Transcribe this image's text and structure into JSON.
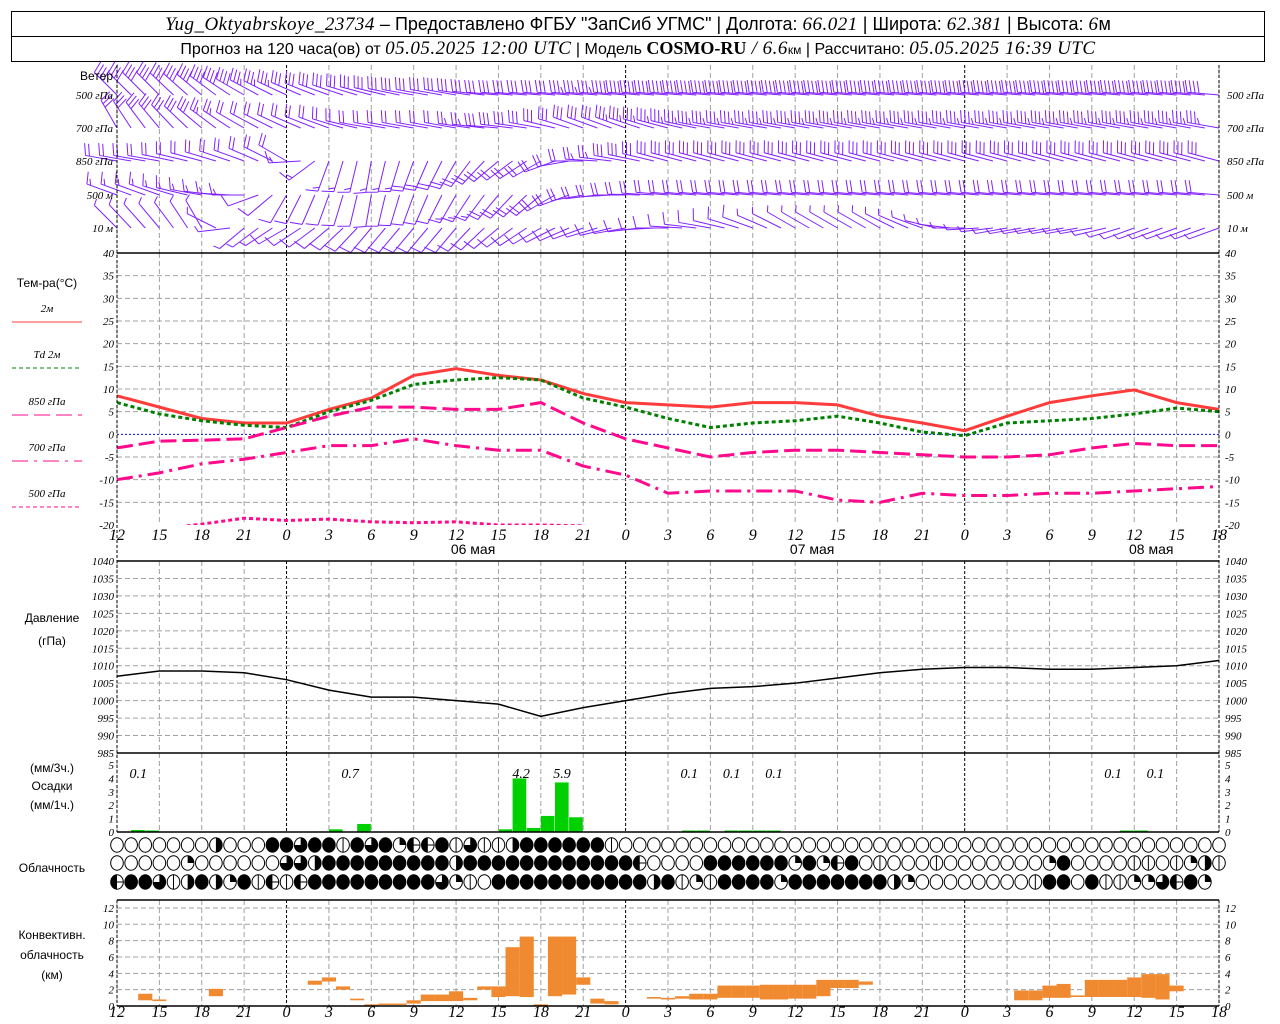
{
  "header": {
    "station": "Yug_Oktyabrskoye_23734",
    "dash": " – ",
    "provided": "Предоставлено ФГБУ \"ЗапСиб УГМС\"",
    "sep": " | ",
    "lon_label": "Долгота: ",
    "lon": "66.021",
    "lat_label": "Широта: ",
    "lat": "62.381",
    "alt_label": "Высота: ",
    "alt": "6",
    "alt_unit": "м",
    "forecast_label": "Прогноз на 120 часа(ов) от ",
    "issued": "05.05.2025 12:00 UTC",
    "model_label": "Модель ",
    "model": "COSMO-RU",
    "res": " / 6.6",
    "res_unit": "км",
    "calc_label": "Рассчитано: ",
    "calc": "05.05.2025 16:39 UTC"
  },
  "chart_data": {
    "type": "meteogram",
    "colors": {
      "wind": "#8020ff",
      "t2m": "#ff3c3c",
      "td2m": "#008000",
      "upper": "#ff0a8c",
      "zero": "#0000ff",
      "precip": "#00d000",
      "conv": "#f08a30",
      "grid": "#a0a0a0"
    },
    "time_axis": {
      "hours": [
        0,
        3,
        6,
        9,
        12,
        15,
        18,
        21,
        24,
        27,
        30,
        33,
        36,
        39,
        42,
        45,
        48,
        51,
        54,
        57,
        60,
        63,
        66,
        69,
        72,
        75,
        78
      ],
      "hour_labels": [
        "12",
        "15",
        "18",
        "21",
        "0",
        "3",
        "6",
        "9",
        "12",
        "15",
        "18",
        "21",
        "0",
        "3",
        "6",
        "9",
        "12",
        "15",
        "18",
        "21",
        "0",
        "3",
        "6",
        "9",
        "12",
        "15",
        "18"
      ],
      "midnights": [
        12,
        36,
        60
      ],
      "dates": [
        {
          "hour": 24,
          "label": "06 мая"
        },
        {
          "hour": 48,
          "label": "07 мая"
        },
        {
          "hour": 72,
          "label": "08 мая"
        }
      ]
    },
    "wind": {
      "title": "Ветер",
      "levels": [
        {
          "label": "500 гПа",
          "dir": [
            315,
            315,
            310,
            300,
            295,
            290,
            285,
            280,
            280,
            275,
            275,
            275,
            275,
            275,
            275,
            275,
            275,
            275,
            275,
            275,
            275,
            275,
            275,
            275,
            275,
            275,
            275
          ],
          "spd": [
            20,
            22,
            22,
            20,
            18,
            15,
            15,
            15,
            15,
            15,
            15,
            18,
            20,
            20,
            20,
            20,
            20,
            20,
            20,
            20,
            20,
            20,
            20,
            20,
            20,
            20,
            20
          ]
        },
        {
          "label": "700 гПа",
          "dir": [
            330,
            320,
            310,
            300,
            295,
            290,
            280,
            280,
            280,
            275,
            280,
            290,
            290,
            285,
            280,
            280,
            280,
            280,
            280,
            280,
            280,
            280,
            280,
            280,
            280,
            280,
            280
          ],
          "spd": [
            15,
            15,
            15,
            12,
            12,
            12,
            12,
            12,
            12,
            15,
            15,
            15,
            18,
            18,
            18,
            18,
            18,
            18,
            18,
            18,
            18,
            18,
            18,
            18,
            18,
            18,
            18
          ]
        },
        {
          "label": "850 гПа",
          "dir": [
            280,
            280,
            285,
            290,
            300,
            200,
            190,
            200,
            210,
            230,
            240,
            270,
            280,
            285,
            285,
            285,
            285,
            285,
            285,
            285,
            285,
            285,
            285,
            285,
            285,
            285,
            285
          ],
          "spd": [
            12,
            12,
            12,
            12,
            10,
            8,
            8,
            10,
            10,
            12,
            12,
            12,
            15,
            15,
            15,
            15,
            15,
            15,
            15,
            15,
            15,
            15,
            15,
            15,
            15,
            15,
            15
          ]
        },
        {
          "label": "500 м",
          "dir": [
            290,
            290,
            280,
            270,
            210,
            200,
            190,
            200,
            210,
            220,
            230,
            260,
            270,
            275,
            275,
            275,
            275,
            275,
            275,
            275,
            275,
            275,
            275,
            275,
            275,
            275,
            275
          ],
          "spd": [
            8,
            8,
            8,
            8,
            6,
            6,
            6,
            6,
            8,
            10,
            10,
            10,
            12,
            12,
            12,
            12,
            12,
            12,
            12,
            12,
            12,
            12,
            12,
            12,
            12,
            12,
            12
          ]
        },
        {
          "label": "10  м",
          "dir": [
            315,
            320,
            330,
            230,
            240,
            230,
            220,
            220,
            220,
            230,
            240,
            250,
            260,
            270,
            280,
            290,
            300,
            300,
            300,
            290,
            270,
            260,
            260,
            260,
            250,
            250,
            250
          ],
          "spd": [
            4,
            4,
            4,
            4,
            5,
            5,
            5,
            5,
            5,
            6,
            6,
            6,
            6,
            5,
            5,
            5,
            4,
            4,
            4,
            4,
            4,
            4,
            4,
            4,
            4,
            4,
            4
          ]
        }
      ]
    },
    "temperature": {
      "title": "Тем-ра(°C)",
      "ylim": [
        -20,
        40
      ],
      "ticks": [
        -20,
        -15,
        -10,
        -5,
        0,
        5,
        10,
        15,
        20,
        25,
        30,
        35,
        40
      ],
      "series": [
        {
          "name": "2м",
          "name_prefix": "",
          "values": [
            8.5,
            6,
            3.5,
            2.5,
            2.5,
            5.5,
            8,
            13,
            14.5,
            13,
            12,
            9,
            7,
            6.5,
            6,
            7,
            7,
            6.5,
            4,
            2.5,
            0.8,
            4,
            7,
            8.5,
            9.8,
            7,
            5.5
          ]
        },
        {
          "name": "2м",
          "name_prefix": "Td",
          "values": [
            7,
            4.5,
            3,
            2,
            1.5,
            5,
            7.5,
            11,
            12,
            12.5,
            12,
            8,
            6,
            3.5,
            1.5,
            2.5,
            3,
            4,
            2.5,
            0.5,
            -0.3,
            2.5,
            3,
            3.5,
            4.5,
            5.8,
            5
          ]
        },
        {
          "name": "гПа",
          "name_prefix": "850",
          "values": [
            -3,
            -1.5,
            -1.3,
            -1,
            1.5,
            4,
            6,
            6,
            5.5,
            5.5,
            7,
            2.5,
            -1,
            -3,
            -5,
            -4,
            -3.5,
            -3.5,
            -4,
            -4.5,
            -5,
            -5,
            -4.5,
            -3,
            -2,
            -2.5,
            -2.5
          ]
        },
        {
          "name": "гПа",
          "name_prefix": "700",
          "values": [
            -10,
            -8.5,
            -6.5,
            -5.5,
            -4,
            -2.5,
            -2.5,
            -1,
            -2.5,
            -3.5,
            -3.5,
            -7,
            -9,
            -13,
            -12.5,
            -12.5,
            -12.5,
            -14.5,
            -15,
            -13,
            -13.5,
            -13.5,
            -13,
            -13,
            -12.5,
            -12,
            -11.5
          ]
        },
        {
          "name": "гПа",
          "name_prefix": "500",
          "values": [
            -22,
            -21,
            -19.8,
            -18.5,
            -19,
            -18.7,
            -19.3,
            -19.5,
            -19.3,
            -20,
            -20,
            -20.2,
            -22,
            -23,
            -23,
            -23,
            -23,
            -23,
            -23,
            -23,
            -23,
            -23,
            -23,
            -23,
            -23,
            -23,
            -23
          ]
        }
      ]
    },
    "pressure": {
      "title": "Давление",
      "unit": "(гПа)",
      "ylim": [
        985,
        1040
      ],
      "ticks": [
        985,
        990,
        995,
        1000,
        1005,
        1010,
        1015,
        1020,
        1025,
        1030,
        1035,
        1040
      ],
      "values": [
        1007,
        1008.5,
        1008.5,
        1008,
        1006,
        1003,
        1001,
        1001,
        1000,
        999,
        995.5,
        998,
        1000,
        1002,
        1003.5,
        1004,
        1005,
        1006.5,
        1008,
        1009,
        1009.5,
        1009.5,
        1009,
        1009,
        1009.5,
        1010,
        1011.5
      ]
    },
    "precipitation": {
      "title": "Осадки",
      "unit_3h": "(мм/3ч.)",
      "unit_1h": "(мм/1ч.)",
      "ylim": [
        0,
        5
      ],
      "ticks": [
        0,
        1,
        2,
        3,
        4,
        5
      ],
      "hourly": [
        {
          "hour": 1,
          "mm": 0.15
        },
        {
          "hour": 2,
          "mm": 0.1
        },
        {
          "hour": 15,
          "mm": 0.2
        },
        {
          "hour": 17,
          "mm": 0.6
        },
        {
          "hour": 27,
          "mm": 0.2
        },
        {
          "hour": 28,
          "mm": 4.0
        },
        {
          "hour": 29,
          "mm": 0.3
        },
        {
          "hour": 30,
          "mm": 1.2
        },
        {
          "hour": 31,
          "mm": 3.7
        },
        {
          "hour": 32,
          "mm": 1.1
        },
        {
          "hour": 40,
          "mm": 0.03
        },
        {
          "hour": 41,
          "mm": 0.03
        },
        {
          "hour": 43,
          "mm": 0.03
        },
        {
          "hour": 44,
          "mm": 0.1
        },
        {
          "hour": 45,
          "mm": 0.1
        },
        {
          "hour": 46,
          "mm": 0.1
        },
        {
          "hour": 71,
          "mm": 0.03
        },
        {
          "hour": 72,
          "mm": 0.1
        }
      ],
      "sums_3h": [
        {
          "hour": 1.5,
          "text": "0.1"
        },
        {
          "hour": 16.5,
          "text": "0.7"
        },
        {
          "hour": 28.6,
          "text": "4.2"
        },
        {
          "hour": 31.5,
          "text": "5.9"
        },
        {
          "hour": 40.5,
          "text": "0.1"
        },
        {
          "hour": 43.5,
          "text": "0.1"
        },
        {
          "hour": 46.5,
          "text": "0.1"
        },
        {
          "hour": 70.5,
          "text": "0.1"
        },
        {
          "hour": 73.5,
          "text": "0.1"
        }
      ]
    },
    "cloudiness": {
      "title": "Облачность",
      "legend": "0=clear, 1=quarter, 2=half, 3=three-quarter, 4=overcast, v=vertical-bar, h=horizontal-bar",
      "rows": [
        "0000000200044344v4341hh4v3vv2444444v0000000000000000000000000000000000000000000",
        "0000010000003324444444442444444444444h0000444444141h40v000v0000000140000vv0v12vv",
        "h443v24214vhvh44444444431v04444444444424v1v4444144444442100000000v4404vv113h41"
      ]
    },
    "convective": {
      "title1": "Конвективн.",
      "title2": "облачность",
      "unit": "(км)",
      "ylim": [
        0,
        13
      ],
      "ticks": [
        0,
        2,
        4,
        6,
        8,
        10,
        12
      ],
      "bars": [
        [
          2,
          0.7,
          1.5
        ],
        [
          3,
          0.6,
          0.8
        ],
        [
          7,
          1.2,
          2.1
        ],
        [
          14,
          2.6,
          3.1
        ],
        [
          15,
          3.0,
          3.5
        ],
        [
          16,
          2.0,
          2.4
        ],
        [
          17,
          0.7,
          0.9
        ],
        [
          18,
          0.1,
          0.2
        ],
        [
          19,
          0.2,
          0.3
        ],
        [
          20,
          0.2,
          0.3
        ],
        [
          21,
          0.3,
          0.7
        ],
        [
          22,
          0.6,
          1.4
        ],
        [
          23,
          0.6,
          1.4
        ],
        [
          24,
          0.6,
          1.8
        ],
        [
          25,
          0.7,
          1.0
        ],
        [
          26,
          2.0,
          2.4
        ],
        [
          27,
          1.1,
          2.4
        ],
        [
          28,
          1.2,
          7.2
        ],
        [
          29,
          1.1,
          8.5
        ],
        [
          30,
          0.1,
          0.2
        ],
        [
          31,
          1.2,
          8.5
        ],
        [
          32,
          1.4,
          8.5
        ],
        [
          33,
          2.6,
          3.5
        ],
        [
          34,
          0.3,
          0.9
        ],
        [
          35,
          0.2,
          0.6
        ],
        [
          38,
          0.9,
          1.1
        ],
        [
          39,
          0.8,
          1.0
        ],
        [
          40,
          0.9,
          1.2
        ],
        [
          41,
          0.8,
          1.5
        ],
        [
          42,
          0.8,
          1.5
        ],
        [
          43,
          1.0,
          2.5
        ],
        [
          44,
          1.0,
          2.5
        ],
        [
          45,
          1.0,
          2.5
        ],
        [
          46,
          0.8,
          2.6
        ],
        [
          47,
          0.8,
          2.6
        ],
        [
          48,
          0.9,
          2.6
        ],
        [
          49,
          0.9,
          2.6
        ],
        [
          50,
          1.2,
          3.2
        ],
        [
          51,
          2.2,
          3.2
        ],
        [
          52,
          2.2,
          3.2
        ],
        [
          53,
          2.6,
          3.0
        ],
        [
          64,
          0.7,
          1.9
        ],
        [
          65,
          0.7,
          1.9
        ],
        [
          66,
          1.0,
          2.5
        ],
        [
          67,
          1.0,
          2.7
        ],
        [
          68,
          1.1,
          1.3
        ],
        [
          69,
          1.1,
          3.2
        ],
        [
          70,
          1.1,
          3.2
        ],
        [
          71,
          1.1,
          3.2
        ],
        [
          72,
          1.1,
          3.5
        ],
        [
          73,
          1.0,
          3.9
        ],
        [
          74,
          0.8,
          3.9
        ],
        [
          75,
          1.8,
          2.5
        ]
      ]
    }
  }
}
